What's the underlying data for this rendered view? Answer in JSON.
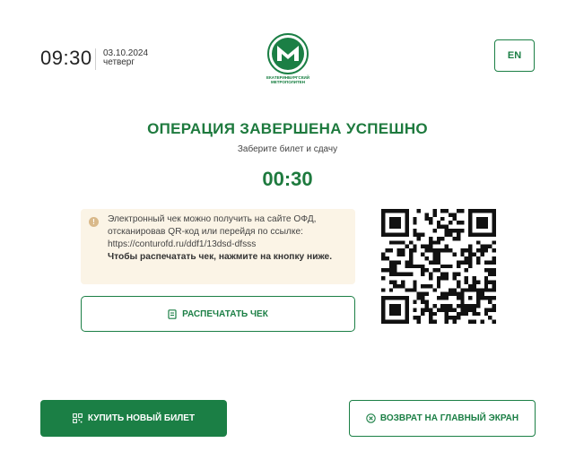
{
  "header": {
    "time": "09:30",
    "date": "03.10.2024",
    "weekday": "четверг",
    "logo_text_line1": "ЕКАТЕРИНБУРГСКИЙ",
    "logo_text_line2": "МЕТРОПОЛИТЕН",
    "lang_label": "EN"
  },
  "status": {
    "title": "ОПЕРАЦИЯ ЗАВЕРШЕНА УСПЕШНО",
    "subtitle": "Заберите билет и сдачу",
    "timer": "00:30"
  },
  "notice": {
    "line1": "Электронный чек можно получить на сайте ОФД,",
    "line2": "отсканировав QR-код или перейдя по ссылке:",
    "line3": "https://conturofd.ru/ddf1/13dsd-dfsss",
    "line4": "Чтобы распечатать чек, нажмите на кнопку ниже.",
    "icon": "info-icon"
  },
  "actions": {
    "print_label": "РАСПЕЧАТАТЬ ЧЕК",
    "buy_label": "КУПИТЬ НОВЫЙ БИЛЕТ",
    "home_label": "ВОЗВРАТ НА ГЛАВНЫЙ ЭКРАН"
  },
  "colors": {
    "accent": "#1b7f45",
    "notice_bg": "#fbf4e6"
  }
}
